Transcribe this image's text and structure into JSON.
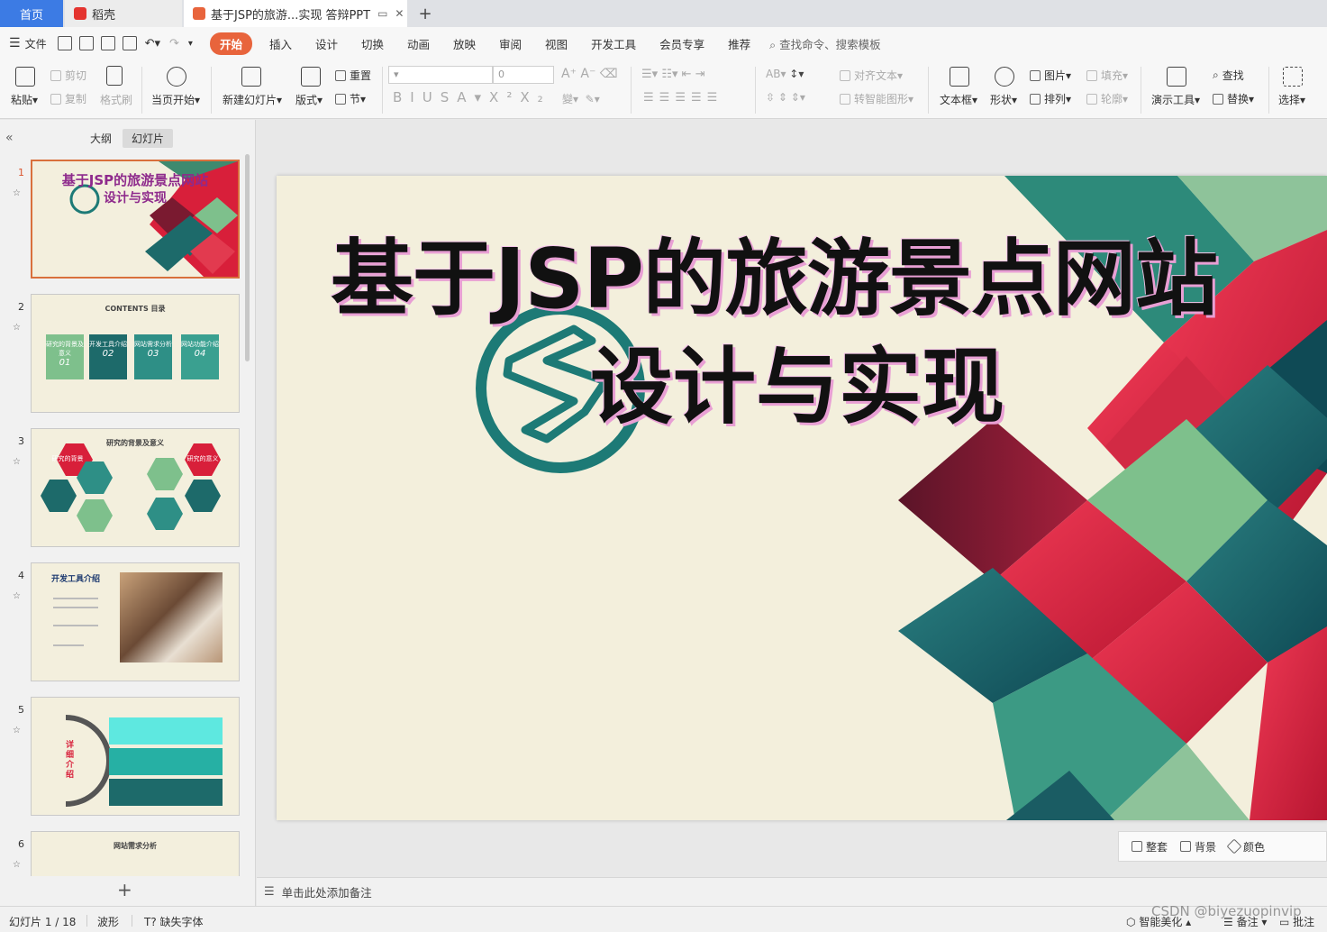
{
  "tabs": {
    "home": "首页",
    "daoke": "稻壳",
    "doc": "基于JSP的旅游...实现 答辩PPT"
  },
  "menu": {
    "file": "文件",
    "items": [
      "开始",
      "插入",
      "设计",
      "切换",
      "动画",
      "放映",
      "审阅",
      "视图",
      "开发工具",
      "会员专享",
      "推荐"
    ],
    "search": "查找命令、搜索模板"
  },
  "ribbon": {
    "paste": "粘贴",
    "cut": "剪切",
    "copy": "复制",
    "format_painter": "格式刷",
    "from_current": "当页开始",
    "new_slide": "新建幻灯片",
    "layout": "版式",
    "reset": "重置",
    "section": "节",
    "font_size": "0",
    "align_text": "对齐文本",
    "smart_shape": "转智能图形",
    "textbox": "文本框",
    "shape": "形状",
    "picture": "图片",
    "arrange": "排列",
    "fill": "填充",
    "outline": "轮廓",
    "present_tools": "演示工具",
    "find": "查找",
    "replace": "替换",
    "select": "选择"
  },
  "left_panel": {
    "tab_outline": "大纲",
    "tab_slides": "幻灯片",
    "thumbs": [
      {
        "num": "1",
        "title": "基于JSP的旅游景点网站",
        "subtitle": "设计与实现"
      },
      {
        "num": "2",
        "title": "CONTENTS 目录",
        "items": [
          "研究的背景及意义",
          "开发工具介绍",
          "网站需求分析",
          "网站功能介绍"
        ],
        "nums": [
          "01",
          "02",
          "03",
          "04"
        ]
      },
      {
        "num": "3",
        "title": "研究的背景及意义",
        "left_label": "研究的背景",
        "right_label": "研究的意义"
      },
      {
        "num": "4",
        "title": "开发工具介绍"
      },
      {
        "num": "5",
        "title": "详细介绍"
      },
      {
        "num": "6",
        "title": "网站需求分析"
      }
    ]
  },
  "slide": {
    "title_line1": "基于JSP的旅游景点网站",
    "title_line2": "设计与实现"
  },
  "float_tools": {
    "beautify": "整套",
    "background": "背景",
    "color": "颜色"
  },
  "notes": {
    "placeholder": "单击此处添加备注"
  },
  "status": {
    "slide_info": "幻灯片 1 / 18",
    "theme": "波形",
    "missing_font": "缺失字体",
    "smart_beautify": "智能美化",
    "notes": "备注",
    "comments": "批注"
  },
  "watermark": "CSDN @biyezuopinvip",
  "colors": {
    "accent": "#e8643c",
    "home_tab": "#3c7be4",
    "slide_bg": "#f3efdc",
    "teal": "#1d7a76",
    "crimson": "#d81f3a"
  }
}
